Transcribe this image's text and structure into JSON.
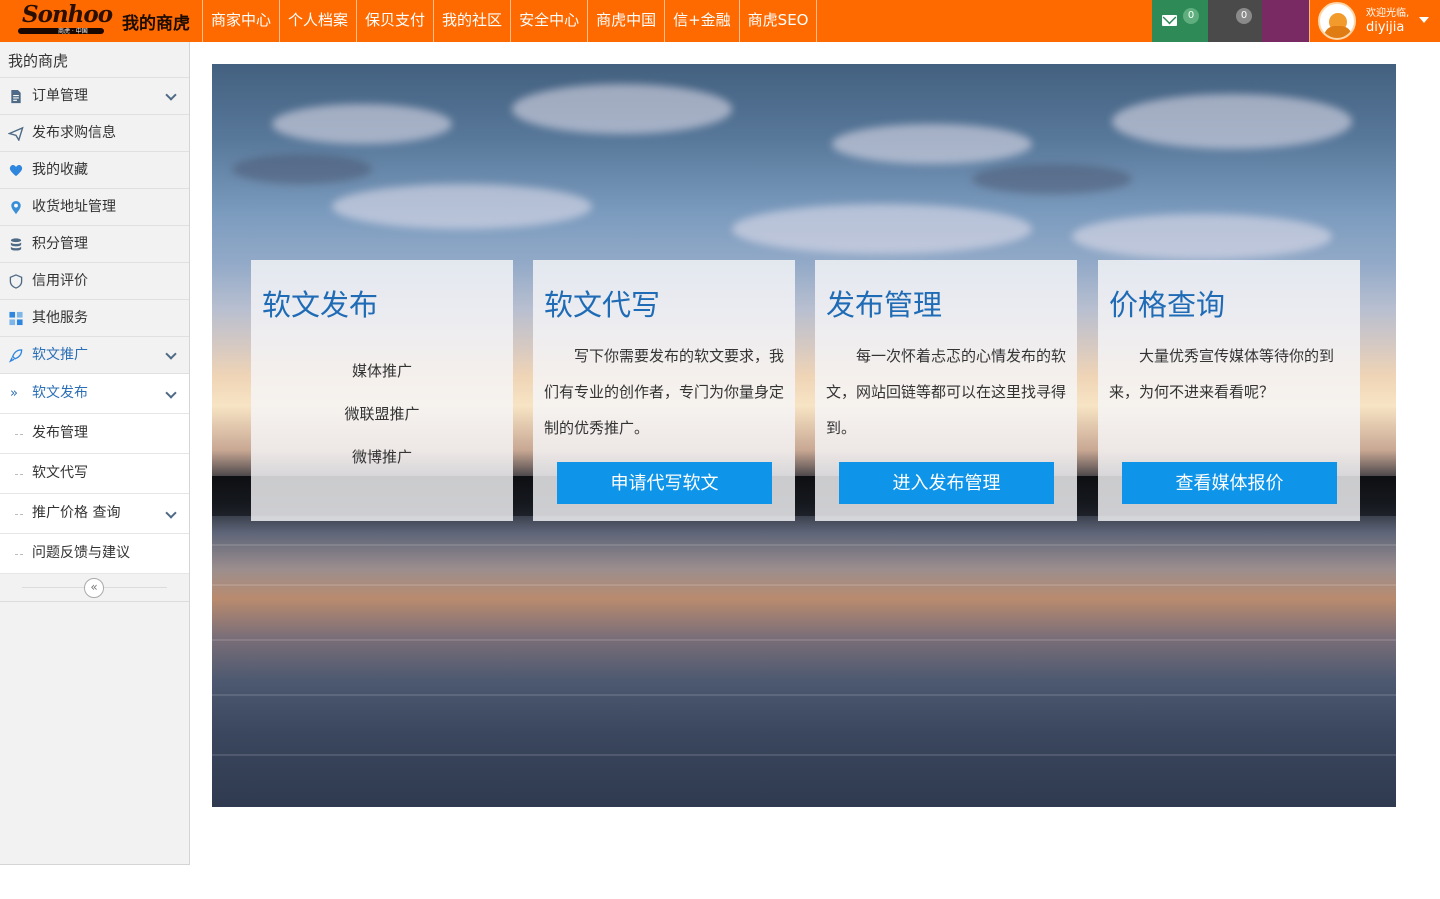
{
  "brand": {
    "logo_word": "Sonhoo",
    "logo_sub": "商虎 · 中国",
    "title": "我的商虎"
  },
  "nav": [
    "商家中心",
    "个人档案",
    "保贝支付",
    "我的社区",
    "安全中心",
    "商虎中国",
    "信+金融",
    "商虎SEO"
  ],
  "header_right": {
    "mail_count": "0",
    "notice_count": "0",
    "welcome": "欢迎光临,",
    "username": "diyijia"
  },
  "sidebar": {
    "title": "我的商虎",
    "items": [
      {
        "label": "订单管理",
        "icon": "document-icon",
        "expandable": true
      },
      {
        "label": "发布求购信息",
        "icon": "paper-plane-icon"
      },
      {
        "label": "我的收藏",
        "icon": "heart-icon"
      },
      {
        "label": "收货地址管理",
        "icon": "location-pin-icon"
      },
      {
        "label": "积分管理",
        "icon": "database-icon"
      },
      {
        "label": "信用评价",
        "icon": "shield-icon"
      },
      {
        "label": "其他服务",
        "icon": "grid-icon"
      },
      {
        "label": "软文推广",
        "icon": "rocket-icon",
        "expandable": true,
        "active": true
      }
    ],
    "sub_open": "软文发布",
    "sub_items": [
      "发布管理",
      "软文代写",
      "推广价格 查询",
      "问题反馈与建议"
    ]
  },
  "cards": [
    {
      "title": "软文发布",
      "links": [
        "媒体推广",
        "微联盟推广",
        "微博推广"
      ]
    },
    {
      "title": "软文代写",
      "text": "写下你需要发布的软文要求，我们有专业的创作者，专门为你量身定制的优秀推广。",
      "button": "申请代写软文"
    },
    {
      "title": "发布管理",
      "text": "每一次怀着忐忑的心情发布的软文，网站回链等都可以在这里找寻得到。",
      "button": "进入发布管理"
    },
    {
      "title": "价格查询",
      "text": "大量优秀宣传媒体等待你的到来，为何不进来看看呢？",
      "button": "查看媒体报价"
    }
  ],
  "colors": {
    "topbar": "#ff6a00",
    "accent_blue": "#0e95ea",
    "title_blue": "#1f6bb5"
  }
}
